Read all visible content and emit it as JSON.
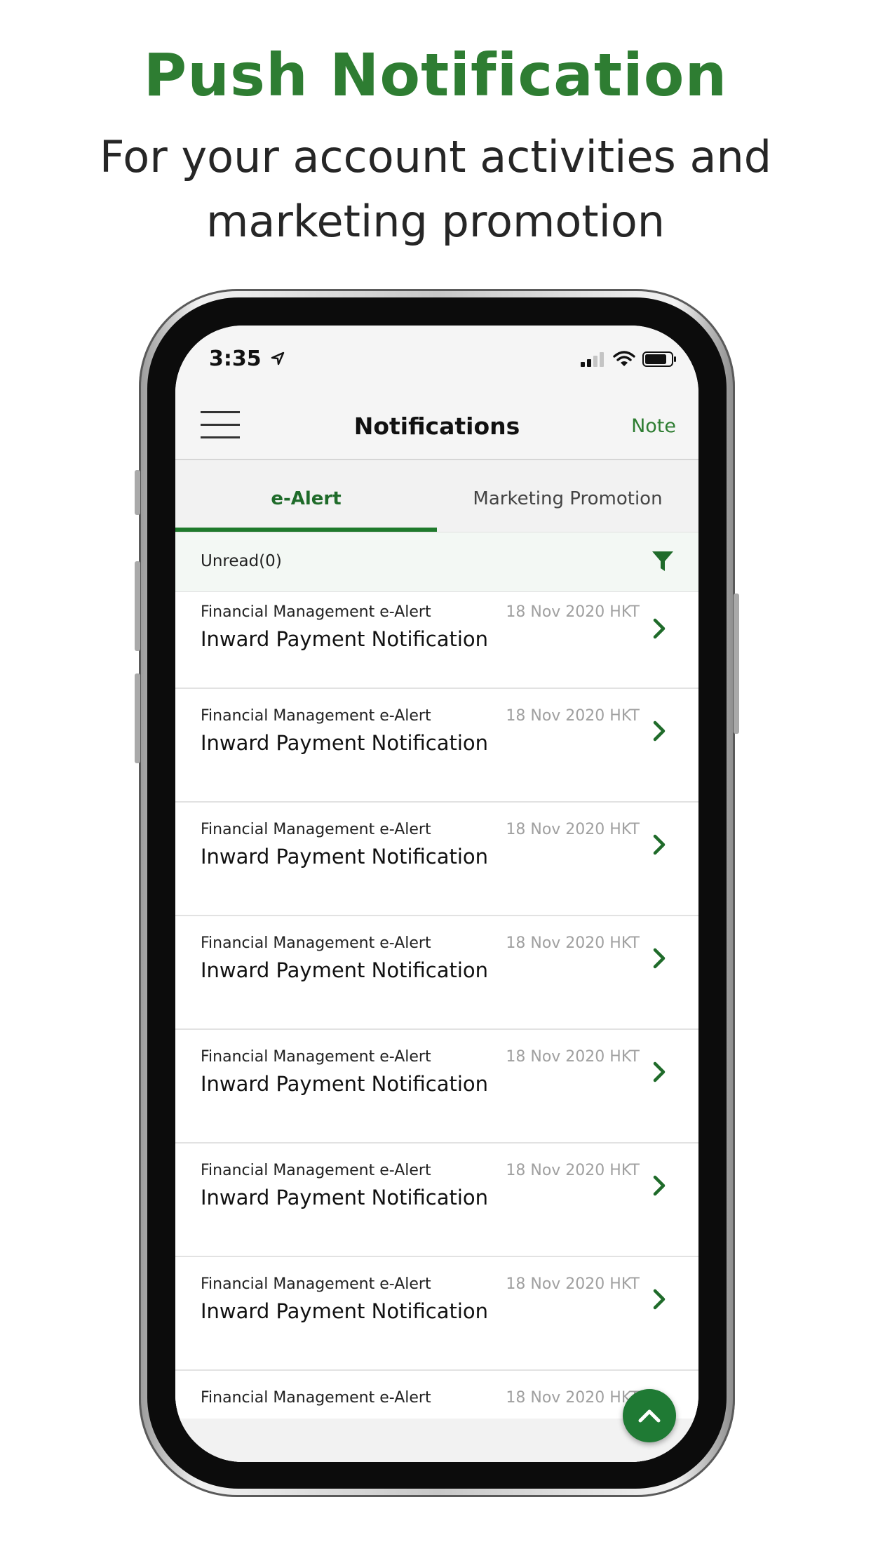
{
  "promo": {
    "headline": "Push Notification",
    "subline_1": "For your account activities and",
    "subline_2": "marketing promotion"
  },
  "status_bar": {
    "time": "3:35",
    "icons": [
      "location-arrow-icon",
      "signal-icon",
      "wifi-icon",
      "battery-icon"
    ]
  },
  "nav": {
    "menu_icon": "hamburger-menu-icon",
    "title": "Notifications",
    "note": "Note"
  },
  "tabs": [
    {
      "label": "e-Alert",
      "active": true
    },
    {
      "label": "Marketing Promotion",
      "active": false
    }
  ],
  "filter": {
    "unread": "Unread(0)",
    "icon": "filter-icon"
  },
  "notifications": [
    {
      "category": "Financial Management e-Alert",
      "date": "18 Nov 2020 HKT",
      "title": "Inward Payment Notification"
    },
    {
      "category": "Financial Management e-Alert",
      "date": "18 Nov 2020 HKT",
      "title": "Inward Payment Notification"
    },
    {
      "category": "Financial Management e-Alert",
      "date": "18 Nov 2020 HKT",
      "title": "Inward Payment Notification"
    },
    {
      "category": "Financial Management e-Alert",
      "date": "18 Nov 2020 HKT",
      "title": "Inward Payment Notification"
    },
    {
      "category": "Financial Management e-Alert",
      "date": "18 Nov 2020 HKT",
      "title": "Inward Payment Notification"
    },
    {
      "category": "Financial Management e-Alert",
      "date": "18 Nov 2020 HKT",
      "title": "Inward Payment Notification"
    },
    {
      "category": "Financial Management e-Alert",
      "date": "18 Nov 2020 HKT",
      "title": "Inward Payment Notification"
    },
    {
      "category": "Financial Management e-Alert",
      "date": "18 Nov 2020 HKT",
      "title": ""
    }
  ],
  "scroll_top_icon": "chevron-up-icon",
  "colors": {
    "brand_green": "#2e7d32",
    "tab_indicator": "#1f7a2c",
    "fab": "#1f7a34"
  }
}
